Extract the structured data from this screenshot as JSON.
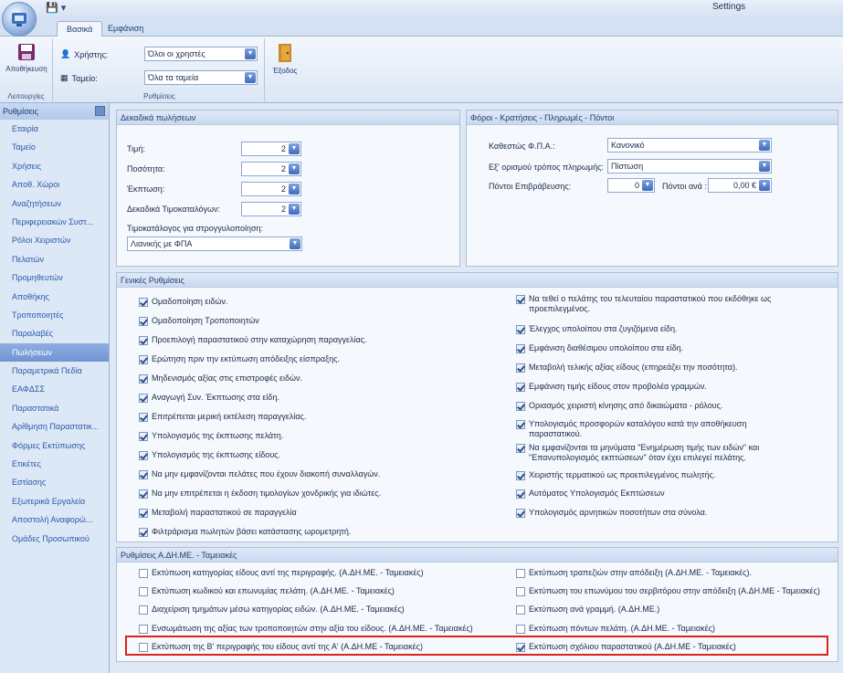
{
  "window": {
    "title": "Settings"
  },
  "tabs": [
    "Βασικά",
    "Εμφάνιση"
  ],
  "ribbon": {
    "save_label": "Αποθήκευση",
    "functions_group": "Λειτουργίες",
    "user_label": "Χρήστης:",
    "user_value": "Όλοι οι χρηστές",
    "register_label": "Ταμείο:",
    "register_value": "Όλα τα ταμεία",
    "settings_group": "Ρυθμίσεις",
    "exit_label": "Έξοδος"
  },
  "nav": {
    "header": "Ρυθμίσεις",
    "items": [
      "Εταιρία",
      "Ταμείο",
      "Χρήσεις",
      "Αποθ. Χώροι",
      "Αναζητήσεων",
      "Περιφερειακών Συστ...",
      "Ρόλοι Χειριστών",
      "Πελατών",
      "Προμηθευτών",
      "Αποθήκης",
      "Τροποποιητές",
      "Παραλαβές",
      "Πωλήσεων",
      "Παραμετρικά Πεδία",
      "ΕΑΦΔΣΣ",
      "Παραστατικά",
      "Αρίθμηση Παραστατικ...",
      "Φόρμες Εκτύπωσης",
      "Ετικέτες",
      "Εστίασης",
      "Εξωτερικά Εργαλεία",
      "Αποστολή Αναφορώ...",
      "Ομάδες Προσωπικού"
    ]
  },
  "decimals": {
    "title": "Δεκαδικά πωλήσεων",
    "price_label": "Τιμή:",
    "price_value": "2",
    "qty_label": "Ποσότητα:",
    "qty_value": "2",
    "discount_label": "Έκπτωση:",
    "discount_value": "2",
    "pricelist_label": "Δεκαδικά Τιμοκαταλόγων:",
    "pricelist_value": "2",
    "rounding_label": "Τιμοκατάλογος για στρογγυλοποίηση:",
    "rounding_value": "Λιανικής με ΦΠΑ"
  },
  "taxes": {
    "title": "Φόροι - Κρατήσεις - Πληρωμές - Πόντοι",
    "vat_label": "Καθεστώς Φ.Π.Α.:",
    "vat_value": "Κανονικό",
    "payment_label": "Εξ' ορισμού τρόπος πληρωμής:",
    "payment_value": "Πίστωση",
    "points_label": "Πόντοι Επιβράβευσης:",
    "points_value": "0",
    "per_label": "Πόντοι ανά :",
    "per_value": "0,00 €"
  },
  "general": {
    "title": "Γενικές Ρυθμίσεις",
    "left": [
      "Ομαδοποίηση ειδών.",
      "Ομαδοποίηση Τροποποιητών",
      "Προεπιλογή παραστατικού στην καταχώρηση παραγγελίας.",
      "Ερώτηση πριν την εκτύπωση απόδειξης είσπραξης.",
      "Μηδενισμός αξίας στις επιστροφές ειδών.",
      "Αναγωγή Συν. Έκπτωσης στα είδη.",
      "Επιτρέπεται μερική εκτέλεση παραγγελίας.",
      "Υπολογισμός της έκπτωσης πελάτη.",
      "Υπολογισμός της έκπτωσης είδους.",
      "Να μην εμφανίζονται πελάτες που έχουν διακοπή συναλλαγών.",
      "Να μην επιτρέπεται η έκδοση τιμολογίων χονδρικής για ιδιώτες.",
      "Μεταβολή παραστατικού σε παραγγελία",
      "Φιλτράρισμα πωλητών βάσει κατάστασης ωρομετρητή."
    ],
    "right": [
      "Να τεθεί ο πελάτης του τελευταίου παραστατικού που εκδόθηκε ως προεπιλεγμένος.",
      "Έλεγχος υπολοίπου στα ζυγιζόμενα είδη.",
      "Εμφάνιση διαθέσιμου υπολοίπου στα είδη.",
      "Μεταβολή τελικής αξίας είδους (επηρεάζει την ποσότητα).",
      "Εμφάνιση τιμής είδους στον προβολέα γραμμών.",
      "Οριασμός χειριστή κίνησης από δικαιώματα - ρόλους.",
      "Υπολογισμός προσφορών καταλόγου κατά την αποθήκευση παραστατικού.",
      "Να εμφανίζονται τα μηνύματα \"Ενημέρωση τιμής των ειδών\" και \"Επανυπολογισμός εκπτώσεων\" όταν έχει επιλεγεί πελάτης.",
      "Χειριστής τερματικού ως προεπιλεγμένος πωλητής.",
      "Αυτόματος Υπολογισμός Εκπτώσεων",
      "Υπολογισμός αρνητικών ποσοτήτων στα σύνολα."
    ]
  },
  "adhme": {
    "title": "Ρυθμίσεις Α.ΔΗ.ΜΕ. - Ταμειακές",
    "left": [
      "Εκτύπωση κατηγορίας είδους αντί της περιγραφής. (Α.ΔΗ.ΜΕ. - Ταμειακές)",
      "Εκτύπωση κωδικού και επωνυμίας πελάτη. (Α.ΔΗ.ΜΕ. - Ταμειακές)",
      "Διαχείριση τμημάτων μέσω κατηγορίας ειδών. (Α.ΔΗ.ΜΕ. - Ταμειακές)",
      "Ενσωμάτωση της αξίας των τροποποιητών στην αξία του είδους. (Α.ΔΗ.ΜΕ. - Ταμειακές)",
      "Εκτύπωση της Β' περιγραφής του είδους αντί της Α' (Α.ΔΗ.ΜΕ - Ταμειακές)"
    ],
    "right": [
      "Εκτύπωση τραπεζιών στην απόδειξη (Α.ΔΗ.ΜΕ. - Ταμειακές).",
      "Εκτύπωση του επωνύμου του σερβιτόρου στην απόδειξη (Α.ΔΗ.ΜΕ - Ταμειακές)",
      "Εκτύπωση ανά γραμμή. (Α.ΔΗ.ΜΕ.)",
      "Εκτύπωση πόντων πελάτη. (Α.ΔΗ.ΜΕ. - Ταμειακές)",
      "Εκτύπωση σχόλιου παραστατικού (Α.ΔΗ.ΜΕ - Ταμειακές)"
    ],
    "right_checked": [
      false,
      false,
      false,
      false,
      true
    ]
  },
  "colors": {
    "highlight": "#d9261c",
    "nav_selected": "#7b9dd8",
    "accent": "#3e6bbd"
  }
}
